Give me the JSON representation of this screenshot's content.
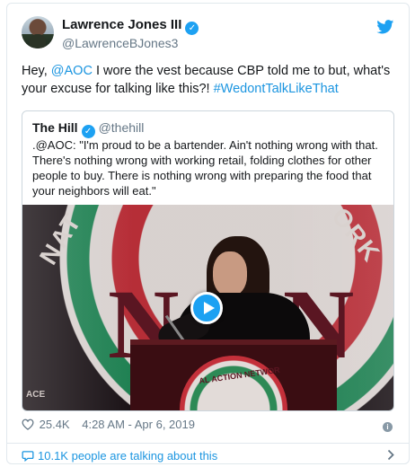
{
  "author": {
    "display_name": "Lawrence Jones III",
    "handle": "@LawrenceBJones3"
  },
  "tweet": {
    "text_parts": {
      "t1": "Hey, ",
      "mention": "@AOC",
      "t2": " I wore the vest because CBP told me to but, what's your excuse for talking like this?! ",
      "hashtag": "#WedontTalkLikeThat"
    }
  },
  "quoted": {
    "name": "The Hill",
    "handle": "@thehill",
    "text": ".@AOC: \"I'm proud to be a bartender. Ain't nothing wrong with that. There's nothing wrong with working retail, folding clothes for other people to buy. There is nothing wrong with preparing the food that your neighbors will eat.\"",
    "media": {
      "letters": "NAN",
      "arc_left": "NAT",
      "arc_right": "ORK",
      "podium_text": "AL ACTION NETWOR",
      "corner_text": "ACE"
    }
  },
  "meta": {
    "likes": "25.4K",
    "timestamp": "4:28 AM - Apr 6, 2019"
  },
  "footer": {
    "conversation": "10.1K people are talking about this"
  },
  "colors": {
    "link": "#1b95e0",
    "verified": "#1da1f2",
    "muted": "#657786"
  },
  "icons": [
    "twitter-bird-icon",
    "verified-icon",
    "play-icon",
    "heart-icon",
    "info-icon",
    "comment-icon",
    "chevron-right-icon"
  ]
}
